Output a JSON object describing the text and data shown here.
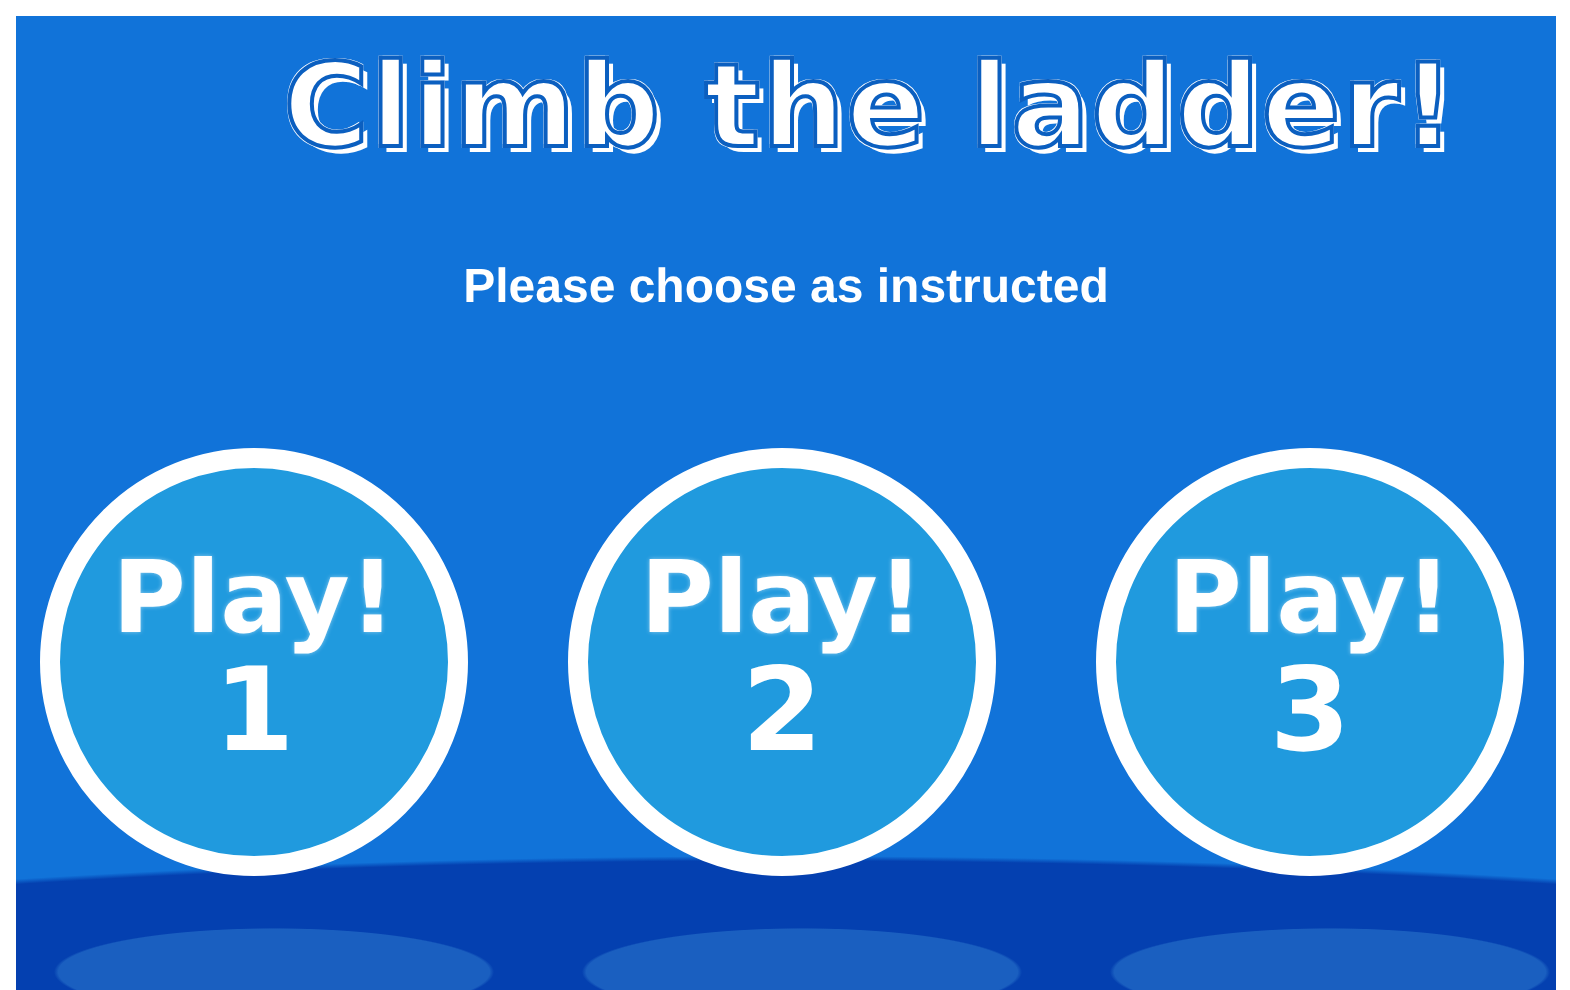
{
  "title": "Climb the ladder!",
  "instruction": "Please choose as instructed",
  "levels": [
    {
      "label": "Play!",
      "number": "1"
    },
    {
      "label": "Play!",
      "number": "2"
    },
    {
      "label": "Play!",
      "number": "3"
    }
  ]
}
